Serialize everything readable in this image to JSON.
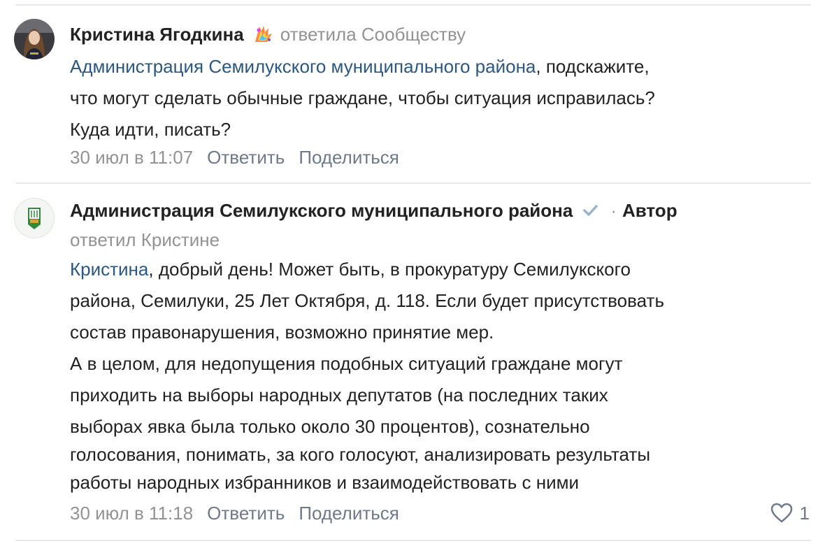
{
  "comment1": {
    "author": "Кристина Ягодкина",
    "reply_note": "ответила Сообществу",
    "mention": "Администрация Семилукского муниципального района",
    "line1_rest": ", подскажите,",
    "line2": "что могут сделать обычные граждане, чтобы ситуация исправилась?",
    "line3": "Куда идти, писать?",
    "date": "30 июл в 11:07",
    "reply_label": "Ответить",
    "share_label": "Поделиться",
    "avatar_icon": "user-photo-icon",
    "badge_icon": "rainbow-sticker-icon"
  },
  "comment2": {
    "author": "Администрация Семилукского муниципального района",
    "verified_icon": "verified-check-icon",
    "role_separator": "·",
    "role": "Автор",
    "reply_note": "ответил Кристине",
    "mention": "Кристина",
    "line1_rest": ", добрый день! Может быть, в прокуратуру Семилукского",
    "lines": [
      "района, Семилуки, 25 Лет Октября, д. 118. Если будет присутствовать",
      "состав правонарушения, возможно принятие мер.",
      "А в целом, для недопущения подобных ситуаций граждане могут",
      "приходить на выборы народных депутатов (на последних таких",
      "выборах явка была только около 30 процентов), сознательно",
      "голосования, понимать, за кого голосуют, анализировать результаты",
      "работы народных избранников и взаимодействовать с ними"
    ],
    "date": "30 июл в 11:18",
    "reply_label": "Ответить",
    "share_label": "Поделиться",
    "likes": "1",
    "like_icon": "heart-icon",
    "avatar_icon": "coat-of-arms-icon"
  },
  "colors": {
    "link": "#2a5885",
    "muted": "#939393",
    "action": "#6d7a8c",
    "divider": "#e7e8ec",
    "verified": "#99b3cf"
  }
}
